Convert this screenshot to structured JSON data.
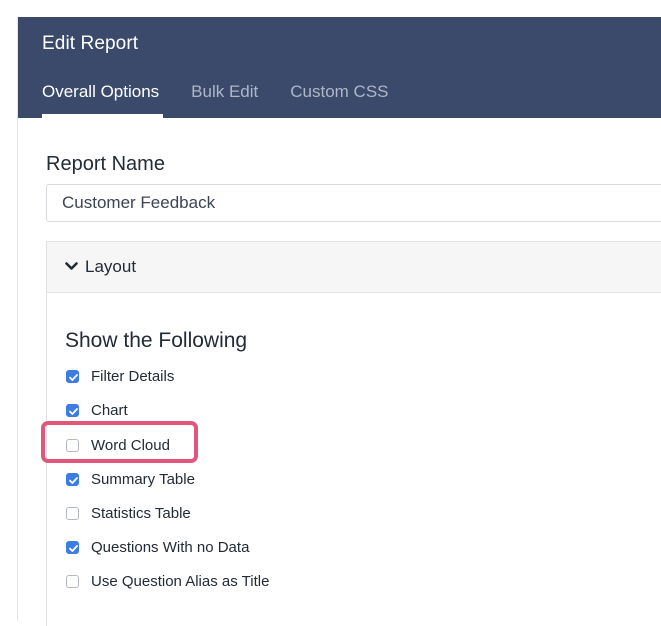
{
  "header": {
    "title": "Edit Report",
    "background": "#3b4a6b"
  },
  "tabs": [
    {
      "label": "Overall Options",
      "active": true
    },
    {
      "label": "Bulk Edit",
      "active": false
    },
    {
      "label": "Custom CSS",
      "active": false
    }
  ],
  "report_name": {
    "label": "Report Name",
    "value": "Customer Feedback"
  },
  "layout": {
    "title": "Layout",
    "expanded": true,
    "show_title": "Show the Following",
    "options": [
      {
        "label": "Filter Details",
        "checked": true
      },
      {
        "label": "Chart",
        "checked": true
      },
      {
        "label": "Word Cloud",
        "checked": false,
        "highlighted": true
      },
      {
        "label": "Summary Table",
        "checked": true
      },
      {
        "label": "Statistics Table",
        "checked": false
      },
      {
        "label": "Questions With no Data",
        "checked": true
      },
      {
        "label": "Use Question Alias as Title",
        "checked": false
      }
    ]
  },
  "colors": {
    "accent": "#3b7de0",
    "highlight": "#e0577b"
  },
  "icons": {
    "chevron": "chevron-down-icon",
    "check": "check-icon"
  }
}
